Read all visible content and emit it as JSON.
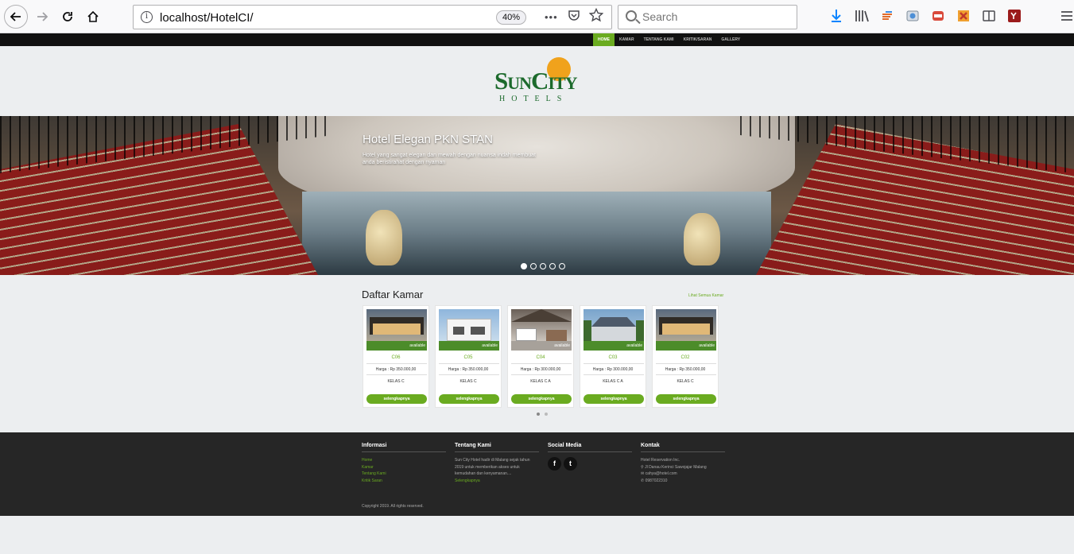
{
  "browser": {
    "url_host": "localhost/HotelCI/",
    "zoom": "40%",
    "search_placeholder": "Search",
    "more_label": "•••"
  },
  "nav": {
    "items": [
      "HOME",
      "KAMAR",
      "TENTANG KAMI",
      "KRITIK/SARAN",
      "GALLERY"
    ],
    "active_index": 0
  },
  "logo": {
    "name": "SunCity",
    "sub": "HOTELS"
  },
  "hero": {
    "title": "Hotel Elegan PKN STAN",
    "text": "Hotel yang sangat elegan dan mewah dengan nuansa indah membuat anda beristirahat dengan nyaman",
    "slide_count": 5,
    "active_slide": 0
  },
  "rooms": {
    "title": "Daftar Kamar",
    "see_all": "Lihat Semua Kamar",
    "cards": [
      {
        "code": "C06",
        "status": "available",
        "price": "Harga : Rp 350.000,00",
        "kelas": "KELAS C",
        "button": "selengkapnya"
      },
      {
        "code": "C05",
        "status": "available",
        "price": "Harga : Rp 350.000,00",
        "kelas": "KELAS C",
        "button": "selengkapnya"
      },
      {
        "code": "C04",
        "status": "available",
        "price": "Harga : Rp 300.000,00",
        "kelas": "KELAS C A",
        "button": "selengkapnya"
      },
      {
        "code": "C03",
        "status": "available",
        "price": "Harga : Rp 300.000,00",
        "kelas": "KELAS C A",
        "button": "selengkapnya"
      },
      {
        "code": "C02",
        "status": "available",
        "price": "Harga : Rp 350.000,00",
        "kelas": "KELAS C",
        "button": "selengkapnya"
      }
    ]
  },
  "footer": {
    "informasi": {
      "title": "Informasi",
      "links": [
        "Home",
        "Kamar",
        "Tentang Kami",
        "Kritik Saran"
      ]
    },
    "tentang": {
      "title": "Tentang Kami",
      "text": "Sun City Hotel hadir di Malang sejak tahun 2019 untuk memberikan akses untuk kemudahan dan kenyamanan....",
      "more": "Selengkapnya"
    },
    "social": {
      "title": "Social Media",
      "icons": [
        "facebook-icon",
        "twitter-icon"
      ],
      "glyphs": [
        "f",
        "t"
      ]
    },
    "kontak": {
      "title": "Kontak",
      "company": "Hotel Reservation Inc.",
      "address": "Jl Danau Kerinci Sawojajar Malang",
      "email": "cahya@hotel.com",
      "phone": "0987022310"
    },
    "copyright": "Copyright 2019. All rights reserved."
  }
}
